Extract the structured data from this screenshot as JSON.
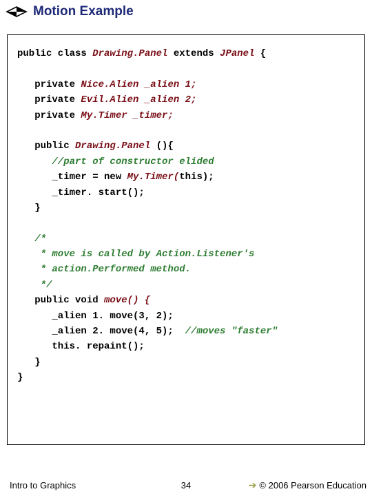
{
  "title": "Motion Example",
  "code": {
    "l1_a": "public class ",
    "l1_b": "Drawing.Panel ",
    "l1_c": "extends ",
    "l1_d": "JPanel ",
    "l1_e": "{",
    "l2_a": "   private ",
    "l2_b": "Nice.Alien _alien 1;",
    "l3_a": "   private ",
    "l3_b": "Evil.Alien _alien 2;",
    "l4_a": "   private ",
    "l4_b": "My.Timer _timer;",
    "l5_a": "   public ",
    "l5_b": "Drawing.Panel ",
    "l5_c": "(){",
    "l6": "      //part of constructor elided",
    "l7_a": "      _timer = ",
    "l7_b": "new ",
    "l7_c": "My.Timer(",
    "l7_d": "this);",
    "l8": "      _timer. start();",
    "l9": "   }",
    "c1": "   /*",
    "c2": "    * move is called by Action.Listener's",
    "c3": "    * action.Performed method.",
    "c4": "    */",
    "l10_a": "   public void ",
    "l10_b": "move() {",
    "l11": "      _alien 1. move(3, 2);",
    "l12_a": "      _alien 2. move(4, 5);  ",
    "l12_b": "//moves \"faster\"",
    "l13_a": "      this",
    "l13_b": ". repaint();",
    "l14": "   }",
    "l15": "}"
  },
  "footer": {
    "left": "Intro to Graphics",
    "center": "34",
    "right": "© 2006 Pearson Education"
  }
}
